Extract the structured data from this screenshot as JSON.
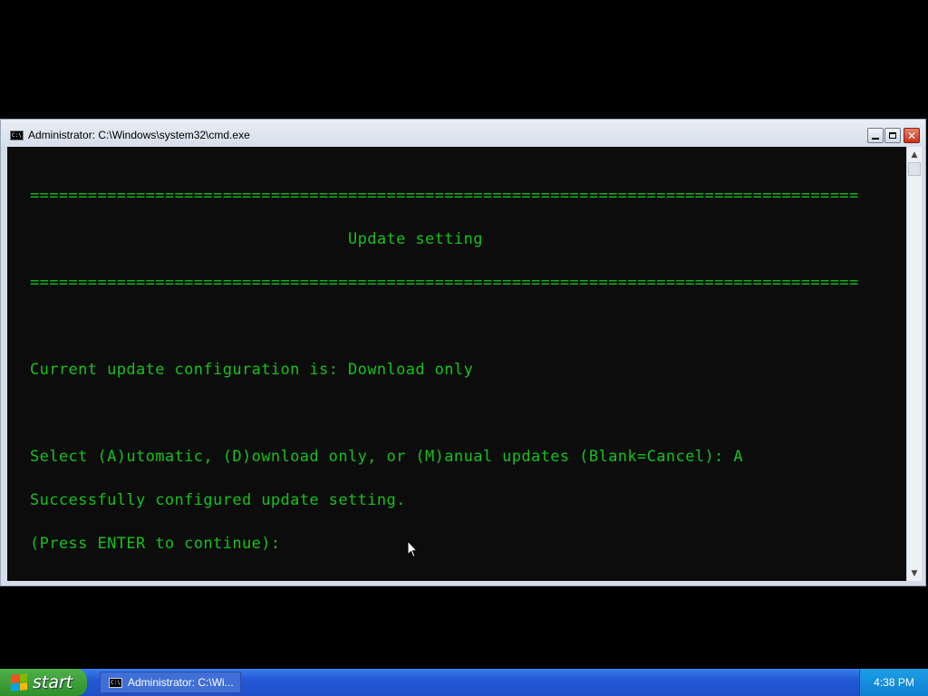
{
  "window": {
    "title": "Administrator: C:\\Windows\\system32\\cmd.exe",
    "icon_label": "C:\\",
    "buttons": {
      "minimize": "minimize",
      "maximize": "maximize",
      "close": "✕"
    }
  },
  "console": {
    "lines": [
      "======================================================================================",
      "                                 Update setting",
      "======================================================================================",
      "",
      "Current update configuration is: Download only",
      "",
      "Select (A)utomatic, (D)ownload only, or (M)anual updates (Blank=Cancel): A",
      "Successfully configured update setting.",
      "(Press ENTER to continue):"
    ],
    "text_color": "#15c11c",
    "background": "#0c0c0c"
  },
  "scrollbar": {
    "up": "▲",
    "down": "▼"
  },
  "taskbar": {
    "start_label": "start",
    "task_label": "Administrator: C:\\Wi...",
    "task_icon_label": "C:\\",
    "clock": "4:38 PM"
  }
}
